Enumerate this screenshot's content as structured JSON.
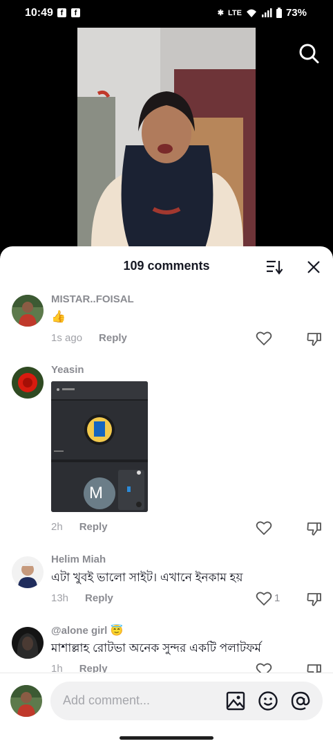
{
  "status": {
    "time": "10:49",
    "battery": "73%",
    "network": "LTE"
  },
  "sheet": {
    "title": "109 comments"
  },
  "comments": [
    {
      "user": "MISTAR..FOISAL",
      "text": "👍",
      "time": "1s ago",
      "reply": "Reply",
      "likes": ""
    },
    {
      "user": "Yeasin",
      "text": "",
      "time": "2h",
      "reply": "Reply",
      "likes": "",
      "image_avatar_letter": "M"
    },
    {
      "user": "Helim Miah",
      "text": "এটা খুবই ভালো সাইট। এখানে ইনকাম হয়",
      "time": "13h",
      "reply": "Reply",
      "likes": "1"
    },
    {
      "user": "@alone girl 😇",
      "text": "মাশাল্লাহ রোটভা অনেক সুন্দর একটি পলাটফর্ম",
      "time": "1h",
      "reply": "Reply",
      "likes": ""
    }
  ],
  "composer": {
    "placeholder": "Add comment..."
  },
  "icons": [
    "search-icon",
    "sort-icon",
    "close-icon",
    "heart-icon",
    "dislike-icon",
    "image-icon",
    "emoji-icon",
    "mention-icon"
  ]
}
